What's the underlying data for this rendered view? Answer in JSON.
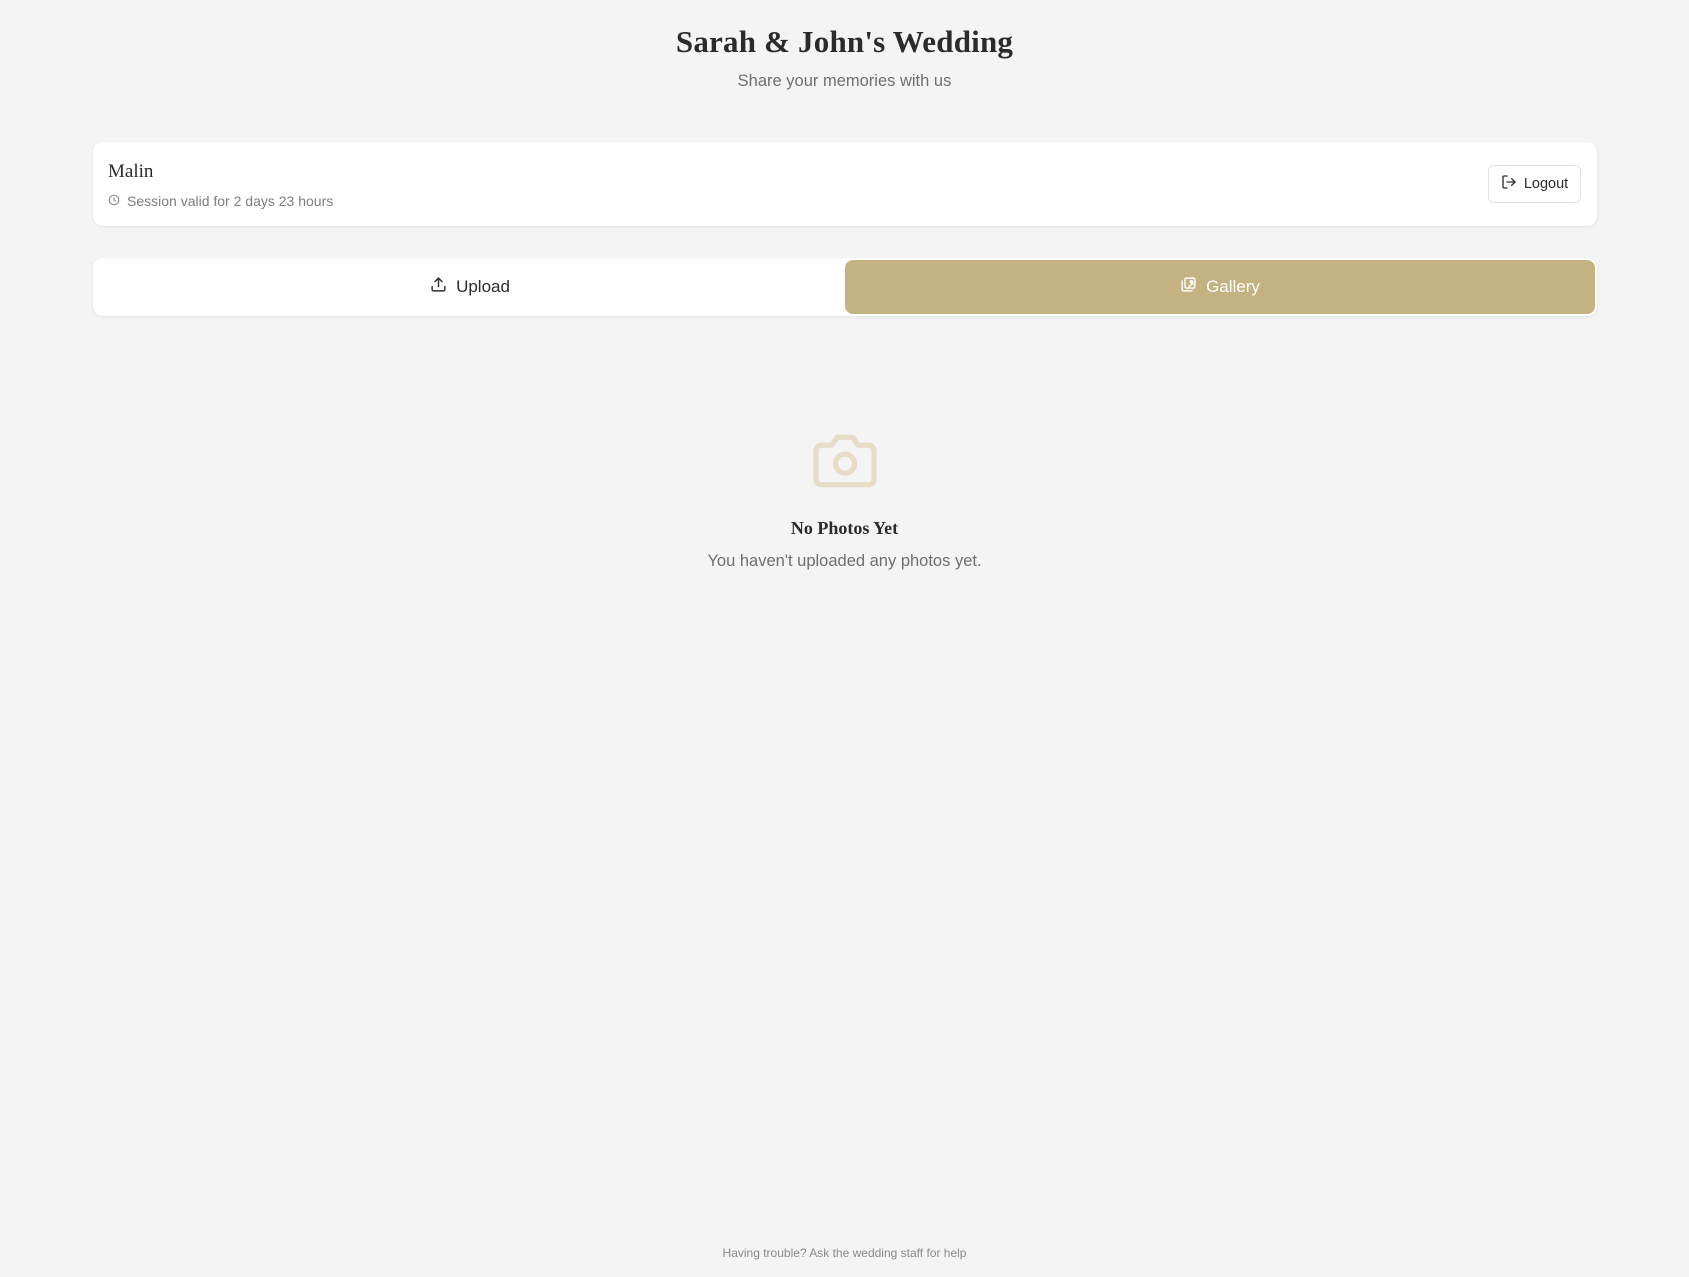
{
  "header": {
    "title": "Sarah & John's Wedding",
    "subtitle": "Share your memories with us"
  },
  "session": {
    "user_name": "Malin",
    "validity_text": "Session valid for 2 days 23 hours",
    "clock_icon": "clock-icon",
    "logout_label": "Logout",
    "logout_icon": "logout-icon"
  },
  "tabs": [
    {
      "label": "Upload",
      "icon": "upload-icon",
      "active": false
    },
    {
      "label": "Gallery",
      "icon": "gallery-icon",
      "active": true
    }
  ],
  "empty_state": {
    "icon": "camera-icon",
    "title": "No Photos Yet",
    "message": "You haven't uploaded any photos yet."
  },
  "footer": {
    "help_text": "Having trouble? Ask the wedding staff for help"
  },
  "colors": {
    "accent": "#c4b280",
    "background": "#f4f4f4",
    "empty_icon": "#e6ddc8"
  }
}
